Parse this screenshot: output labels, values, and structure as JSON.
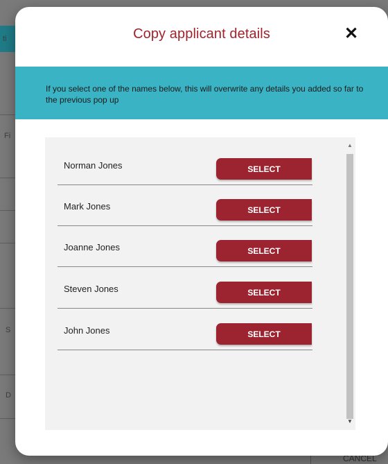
{
  "background": {
    "fragments": [
      "ti",
      "Fi",
      "S",
      "D"
    ],
    "cancel_label": "CANCEL"
  },
  "modal": {
    "title": "Copy applicant details",
    "close_glyph": "✕",
    "info_text": "If you select one of the names below, this will overwrite any details you added so far to the previous pop up",
    "applicants": [
      {
        "name": "Norman Jones",
        "button": "SELECT"
      },
      {
        "name": "Mark Jones",
        "button": "SELECT"
      },
      {
        "name": "Joanne Jones",
        "button": "SELECT"
      },
      {
        "name": "Steven Jones",
        "button": "SELECT"
      },
      {
        "name": "John Jones",
        "button": "SELECT"
      }
    ],
    "scroll_up_glyph": "▲",
    "scroll_down_glyph": "▼"
  },
  "colors": {
    "title": "#a0232c",
    "banner": "#3ab4c4",
    "button": "#9c2430",
    "overlay": "#7a7a7a"
  }
}
